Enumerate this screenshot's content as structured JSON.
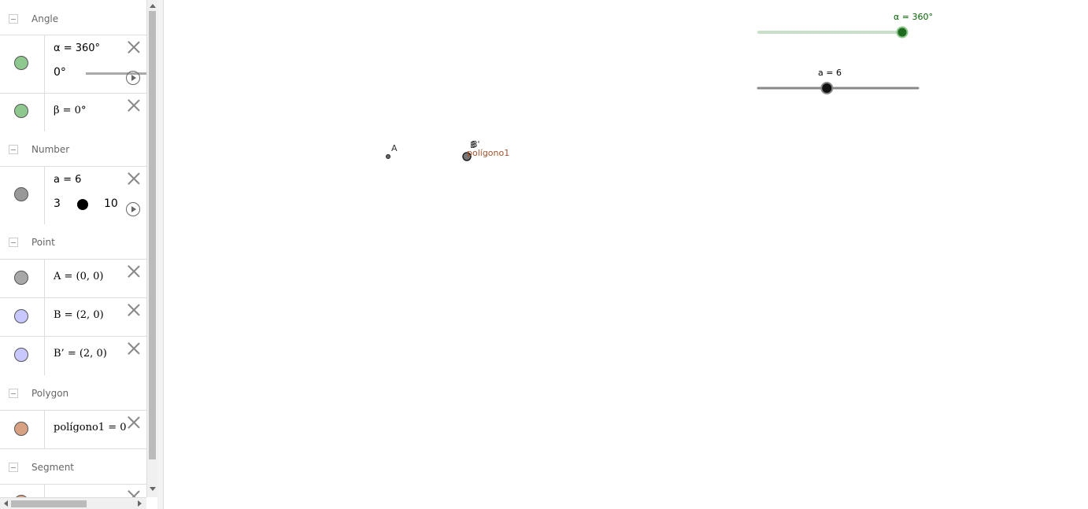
{
  "algebra": {
    "groups": {
      "angle": "Angle",
      "number": "Number",
      "point": "Point",
      "polygon": "Polygon",
      "segment": "Segment"
    },
    "alpha": {
      "definition": "α = 360°",
      "slider_min": "0°",
      "marble_color": "#8fc88f"
    },
    "beta": {
      "definition": "β = 0°",
      "marble_color": "#8fc88f"
    },
    "a": {
      "definition": "a = 6",
      "slider_min": "3",
      "slider_max": "10",
      "slider_fraction": 0.43,
      "marble_color": "#999999"
    },
    "A": {
      "definition": "A = (0, 0)",
      "marble_color": "#a8a8a8"
    },
    "B": {
      "definition": "B = (2, 0)",
      "marble_color": "#c8c8ff"
    },
    "Bprime": {
      "definition": "B’ = (2, 0)",
      "marble_color": "#c8c8ff"
    },
    "poly": {
      "definition": "polígono1 = 0",
      "marble_color": "#d9a184"
    }
  },
  "graphics": {
    "alpha_slider": {
      "label": "α = 360°",
      "fraction": 1.0,
      "color": "#006400"
    },
    "a_slider": {
      "label": "a = 6",
      "fraction": 0.43,
      "color": "#000000"
    },
    "point_A_label": "A",
    "point_B_label": "B",
    "point_Bprime_label": "B'",
    "polygon_label": "polígono1",
    "polygon_color": "#a0522d"
  }
}
